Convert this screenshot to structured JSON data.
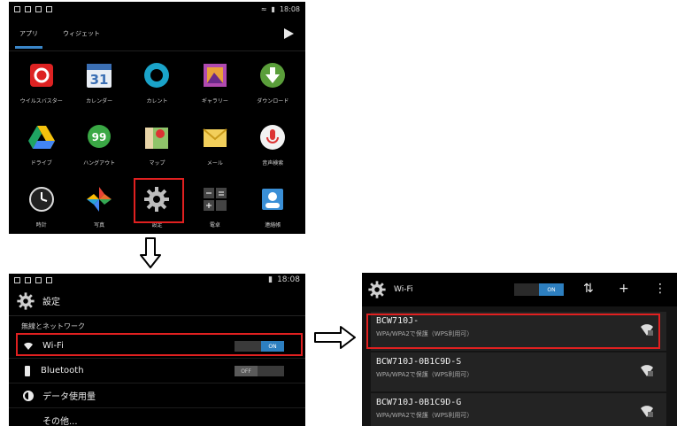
{
  "drawer": {
    "status_right": "18:08",
    "tabs": [
      "アプリ",
      "ウィジェット"
    ],
    "apps": [
      {
        "label": "ウイルスバスター",
        "icon": "virus-buster-icon"
      },
      {
        "label": "カレンダー",
        "icon": "calendar-icon",
        "glyph": "31"
      },
      {
        "label": "カレント",
        "icon": "current-icon"
      },
      {
        "label": "ギャラリー",
        "icon": "gallery-icon"
      },
      {
        "label": "ダウンロード",
        "icon": "download-icon"
      },
      {
        "label": "ドライブ",
        "icon": "drive-icon"
      },
      {
        "label": "ハングアウト",
        "icon": "hangouts-icon",
        "glyph": "99"
      },
      {
        "label": "マップ",
        "icon": "maps-icon"
      },
      {
        "label": "メール",
        "icon": "mail-icon"
      },
      {
        "label": "音声検索",
        "icon": "voice-search-icon"
      },
      {
        "label": "時計",
        "icon": "clock-icon"
      },
      {
        "label": "写真",
        "icon": "photos-icon"
      },
      {
        "label": "設定",
        "icon": "settings-icon"
      },
      {
        "label": "電卓",
        "icon": "calculator-icon"
      },
      {
        "label": "連絡帳",
        "icon": "contacts-icon"
      }
    ]
  },
  "settings": {
    "status_time": "18:08",
    "title": "設定",
    "section": "無線とネットワーク",
    "rows": [
      {
        "label": "Wi-Fi",
        "toggle": "ON"
      },
      {
        "label": "Bluetooth",
        "toggle": "OFF"
      },
      {
        "label": "データ使用量",
        "toggle": ""
      },
      {
        "label": "その他...",
        "toggle": ""
      }
    ]
  },
  "wifi": {
    "title": "Wi-Fi",
    "toggle": "ON",
    "networks": [
      {
        "name": "BCW710J-",
        "status": "WPA/WPA2で保護（WPS利用可）"
      },
      {
        "name": "BCW710J-0B1C9D-S",
        "status": "WPA/WPA2で保護（WPS利用可）"
      },
      {
        "name": "BCW710J-0B1C9D-G",
        "status": "WPA/WPA2で保護（WPS利用可）"
      }
    ]
  },
  "colors": {
    "highlight": "#e02020",
    "accent": "#2d7fc0"
  }
}
